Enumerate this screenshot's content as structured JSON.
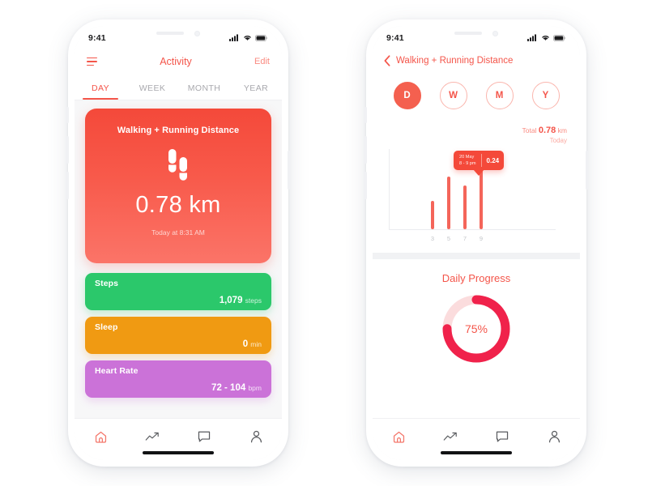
{
  "statusbar": {
    "time": "9:41",
    "signal_icon": "cellular-bars-icon",
    "wifi_icon": "wifi-icon",
    "battery_icon": "battery-icon"
  },
  "colors": {
    "accent_red": "#F4554A",
    "card_gradient_top": "#F4493A",
    "card_gradient_bottom": "#FB7468",
    "green": "#2BC86B",
    "orange": "#F09A12",
    "purple": "#CB72D8",
    "ring_progress": "#F0224B",
    "ring_track": "#FBDCDD"
  },
  "phone1": {
    "nav": {
      "menu_icon": "hamburger-menu-icon",
      "title": "Activity",
      "edit_label": "Edit"
    },
    "segments": [
      {
        "label": "DAY",
        "active": true
      },
      {
        "label": "WEEK",
        "active": false
      },
      {
        "label": "MONTH",
        "active": false
      },
      {
        "label": "YEAR",
        "active": false
      }
    ],
    "main_card": {
      "title": "Walking + Running Distance",
      "icon": "footprints-icon",
      "value": "0.78 km",
      "subtitle": "Today at 8:31 AM"
    },
    "stats": [
      {
        "label": "Steps",
        "value": "1,079",
        "unit": "steps",
        "color": "#2BC86B"
      },
      {
        "label": "Sleep",
        "value": "0",
        "unit": "min",
        "color": "#F09A12"
      },
      {
        "label": "Heart Rate",
        "value": "72 - 104",
        "unit": "bpm",
        "color": "#CB72D8"
      }
    ]
  },
  "phone2": {
    "nav": {
      "back_icon": "chevron-left-icon",
      "title": "Walking + Running Distance"
    },
    "ranges": [
      {
        "label": "D",
        "active": true
      },
      {
        "label": "W",
        "active": false
      },
      {
        "label": "M",
        "active": false
      },
      {
        "label": "Y",
        "active": false
      }
    ],
    "total": {
      "prefix": "Total",
      "value": "0.78",
      "unit": "km",
      "period": "Today"
    },
    "tooltip": {
      "date": "20 May",
      "time_range": "8 - 9 pm",
      "value": "0.24"
    },
    "progress": {
      "title": "Daily Progress",
      "percent_label": "75%",
      "percent": 75
    }
  },
  "chart_data": {
    "type": "bar",
    "title": "Walking + Running Distance",
    "xlabel": "",
    "ylabel": "km",
    "categories": [
      "3",
      "5",
      "7",
      "9"
    ],
    "values": [
      0.09,
      0.17,
      0.14,
      0.24
    ],
    "ylim": [
      0,
      0.26
    ],
    "grid": false,
    "legend": "none",
    "annotations": [
      {
        "category": "9",
        "date": "20 May",
        "time_range": "8 - 9 pm",
        "value": "0.24"
      }
    ],
    "total": 0.78,
    "units": "km"
  },
  "tabbar": [
    {
      "icon": "home-icon",
      "active": true
    },
    {
      "icon": "trending-up-icon",
      "active": false
    },
    {
      "icon": "chat-bubble-icon",
      "active": false
    },
    {
      "icon": "person-icon",
      "active": false
    }
  ]
}
